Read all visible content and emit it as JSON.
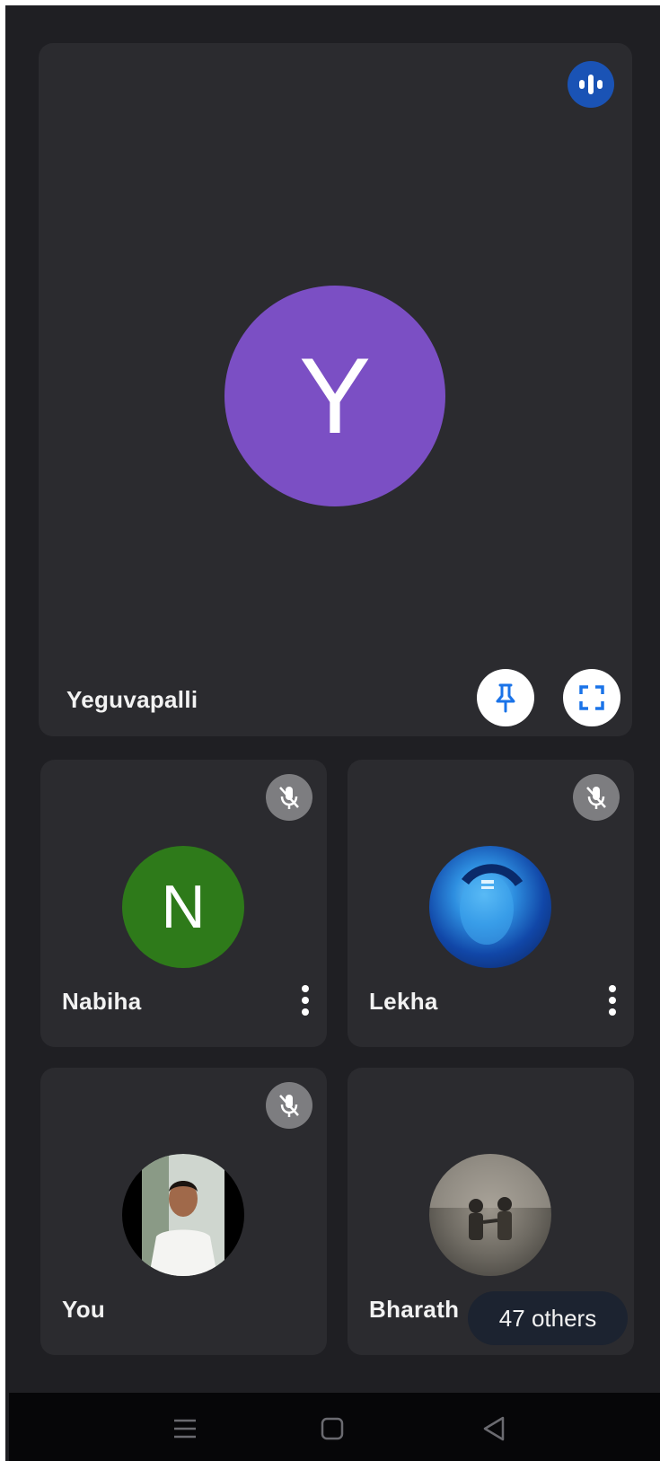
{
  "main_tile": {
    "name": "Yeguvapalli",
    "initial": "Y",
    "avatar_color": "#7b4fc4",
    "status_icon": "audio-speaking-icon",
    "actions": [
      "pin-icon",
      "fullscreen-icon"
    ]
  },
  "participants": [
    {
      "name": "Nabiha",
      "initial": "N",
      "avatar_color": "#2e7a1a",
      "muted": true
    },
    {
      "name": "Lekha",
      "avatar": "profile-photo",
      "muted": true
    },
    {
      "name": "You",
      "avatar": "profile-photo",
      "muted": true
    },
    {
      "name": "Bharath",
      "avatar": "profile-photo",
      "muted": false
    }
  ],
  "others": {
    "label": "47 others"
  },
  "nav": {
    "buttons": [
      "menu-icon",
      "home-icon",
      "back-icon"
    ]
  },
  "colors": {
    "background": "#1f1f23",
    "tile": "#2b2b2f",
    "accent_blue": "#1a53b5",
    "muted_badge": "#7d7d80"
  }
}
